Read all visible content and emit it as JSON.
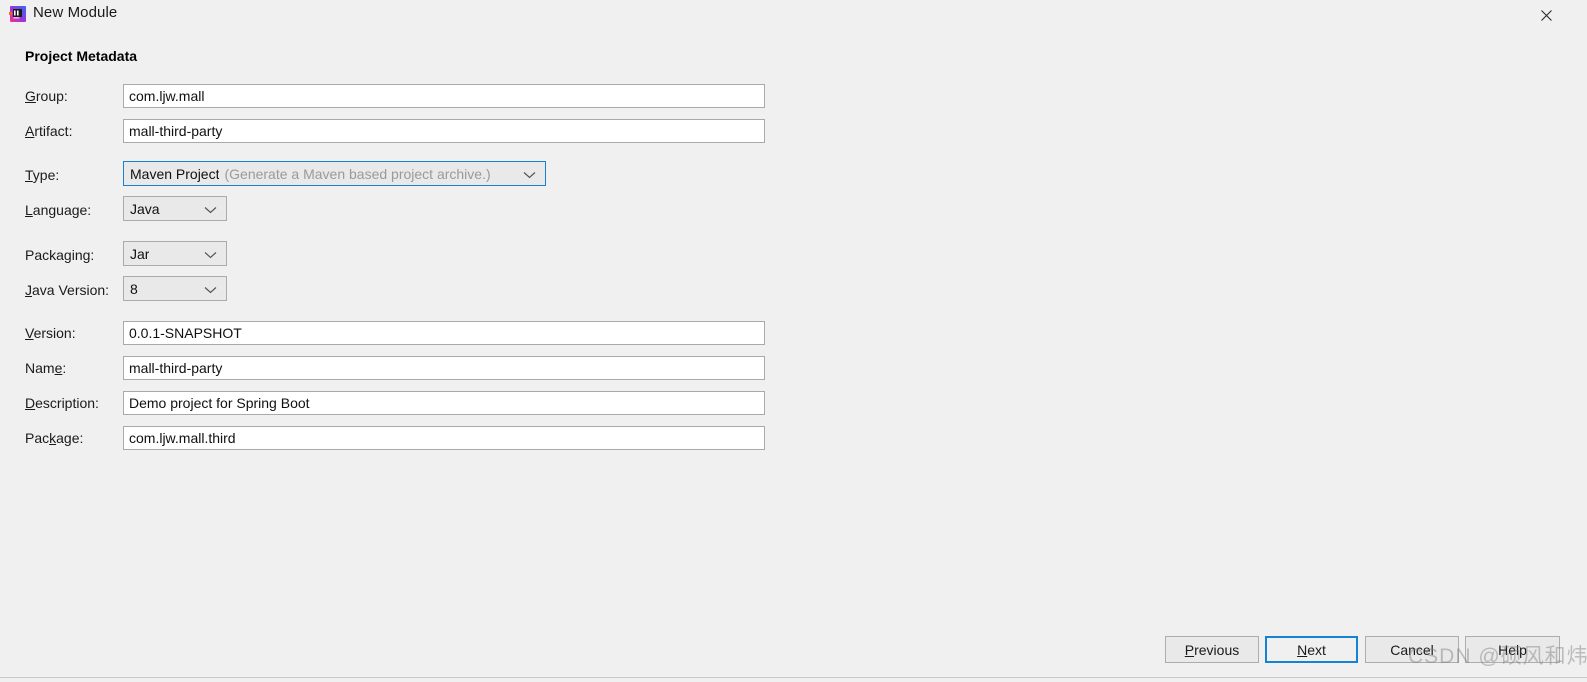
{
  "window": {
    "title": "New Module",
    "app_icon": "intellij-idea-icon",
    "close_icon": "close-icon"
  },
  "section": {
    "heading": "Project Metadata"
  },
  "form": {
    "fields": [
      {
        "id": "group",
        "label_pre": "",
        "label_mnemonic": "G",
        "label_post": "roup:",
        "type": "text",
        "value": "com.ljw.mall",
        "placeholder": ""
      },
      {
        "id": "artifact",
        "label_pre": "",
        "label_mnemonic": "A",
        "label_post": "rtifact:",
        "type": "text",
        "value": "mall-third-party",
        "placeholder": ""
      },
      {
        "id": "type",
        "label_pre": "",
        "label_mnemonic": "T",
        "label_post": "ype:",
        "type": "combo",
        "value": "Maven Project",
        "hint": "(Generate a Maven based project archive.)",
        "focused": true
      },
      {
        "id": "language",
        "label_pre": "",
        "label_mnemonic": "L",
        "label_post": "anguage:",
        "type": "combo",
        "value": "Java",
        "hint": "",
        "focused": false
      },
      {
        "id": "packaging",
        "label_pre": "Packa",
        "label_mnemonic": "g",
        "label_post": "ing:",
        "type": "combo",
        "value": "Jar",
        "hint": "",
        "focused": false
      },
      {
        "id": "javaversion",
        "label_pre": "",
        "label_mnemonic": "J",
        "label_post": "ava Version:",
        "type": "combo",
        "value": "8",
        "hint": "",
        "focused": false
      },
      {
        "id": "version",
        "label_pre": "",
        "label_mnemonic": "V",
        "label_post": "ersion:",
        "type": "text",
        "value": "0.0.1-SNAPSHOT",
        "placeholder": ""
      },
      {
        "id": "name",
        "label_pre": "Nam",
        "label_mnemonic": "e",
        "label_post": ":",
        "type": "text",
        "value": "mall-third-party",
        "placeholder": ""
      },
      {
        "id": "description",
        "label_pre": "",
        "label_mnemonic": "D",
        "label_post": "escription:",
        "type": "text",
        "value": "Demo project for Spring Boot",
        "placeholder": ""
      },
      {
        "id": "package",
        "label_pre": "Pac",
        "label_mnemonic": "k",
        "label_post": "age:",
        "type": "text",
        "value": "com.ljw.mall.third",
        "placeholder": ""
      }
    ]
  },
  "footer": {
    "buttons": [
      {
        "id": "previous",
        "pre": "",
        "mnemonic": "P",
        "post": "revious",
        "default": false
      },
      {
        "id": "next",
        "pre": "",
        "mnemonic": "N",
        "post": "ext",
        "default": true
      },
      {
        "id": "cancel",
        "pre": "Cancel",
        "mnemonic": "",
        "post": "",
        "default": false
      },
      {
        "id": "help",
        "pre": "Help",
        "mnemonic": "",
        "post": "",
        "default": false
      }
    ]
  },
  "watermark": {
    "text": "CSDN @硕风和炜"
  },
  "colors": {
    "background": "#f0f0f0",
    "field_background": "#ffffff",
    "field_border": "#a9a9a9",
    "combo_background": "#e9e9e9",
    "focus_blue": "#1583d4",
    "hint_gray": "#9a9a9a"
  }
}
